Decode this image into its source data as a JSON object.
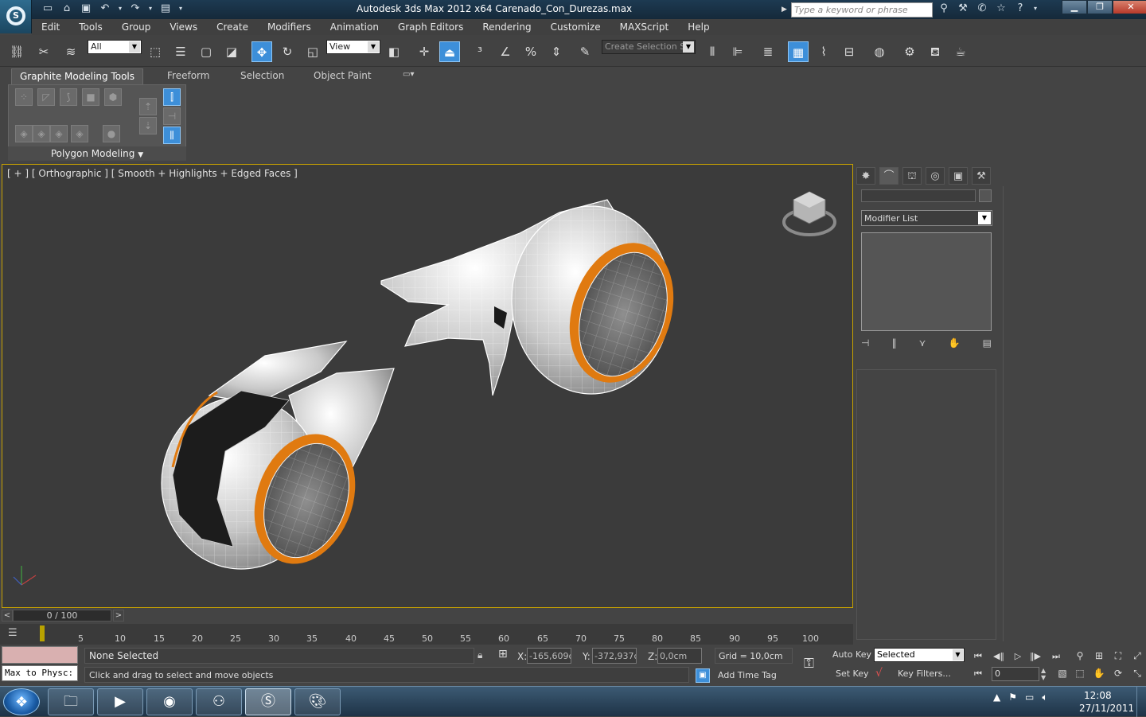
{
  "window": {
    "title": "Autodesk 3ds Max  2012 x64      Carenado_Con_Durezas.max",
    "search_placeholder": "Type a keyword or phrase"
  },
  "menu": [
    "Edit",
    "Tools",
    "Group",
    "Views",
    "Create",
    "Modifiers",
    "Animation",
    "Graph Editors",
    "Rendering",
    "Customize",
    "MAXScript",
    "Help"
  ],
  "toolbar": {
    "selection_filter": "All",
    "ref_coord": "View",
    "named_selection_placeholder": "Create Selection Se"
  },
  "ribbon": {
    "tabs": [
      "Graphite Modeling Tools",
      "Freeform",
      "Selection",
      "Object Paint"
    ],
    "panel_label": "Polygon Modeling"
  },
  "viewport": {
    "label": "[ + ] [ Orthographic ] [ Smooth + Highlights + Edged Faces ]"
  },
  "command_panel": {
    "modifier_list_label": "Modifier List"
  },
  "timeline": {
    "slider_label": "0 / 100",
    "ticks": [
      "5",
      "10",
      "15",
      "20",
      "25",
      "30",
      "35",
      "40",
      "45",
      "50",
      "55",
      "60",
      "65",
      "70",
      "75",
      "80",
      "85",
      "90",
      "95",
      "100"
    ]
  },
  "status": {
    "listener_text": "Max to Physc:",
    "selection": "None Selected",
    "prompt": "Click and drag to select and move objects",
    "x_label": "X:",
    "x_value": "-165,609cr",
    "y_label": "Y:",
    "y_value": "-372,937cr",
    "z_label": "Z:",
    "z_value": "0,0cm",
    "grid": "Grid = 10,0cm",
    "add_time_tag": "Add Time Tag",
    "auto_key": "Auto Key",
    "set_key": "Set Key",
    "key_mode": "Selected",
    "key_filters": "Key Filters...",
    "current_frame": "0"
  },
  "taskbar": {
    "time": "12:08",
    "date": "27/11/2011"
  },
  "colors": {
    "viewport_border": "#c8a200",
    "active_tool": "#3d8fd9",
    "rim_orange": "#e07a10"
  }
}
